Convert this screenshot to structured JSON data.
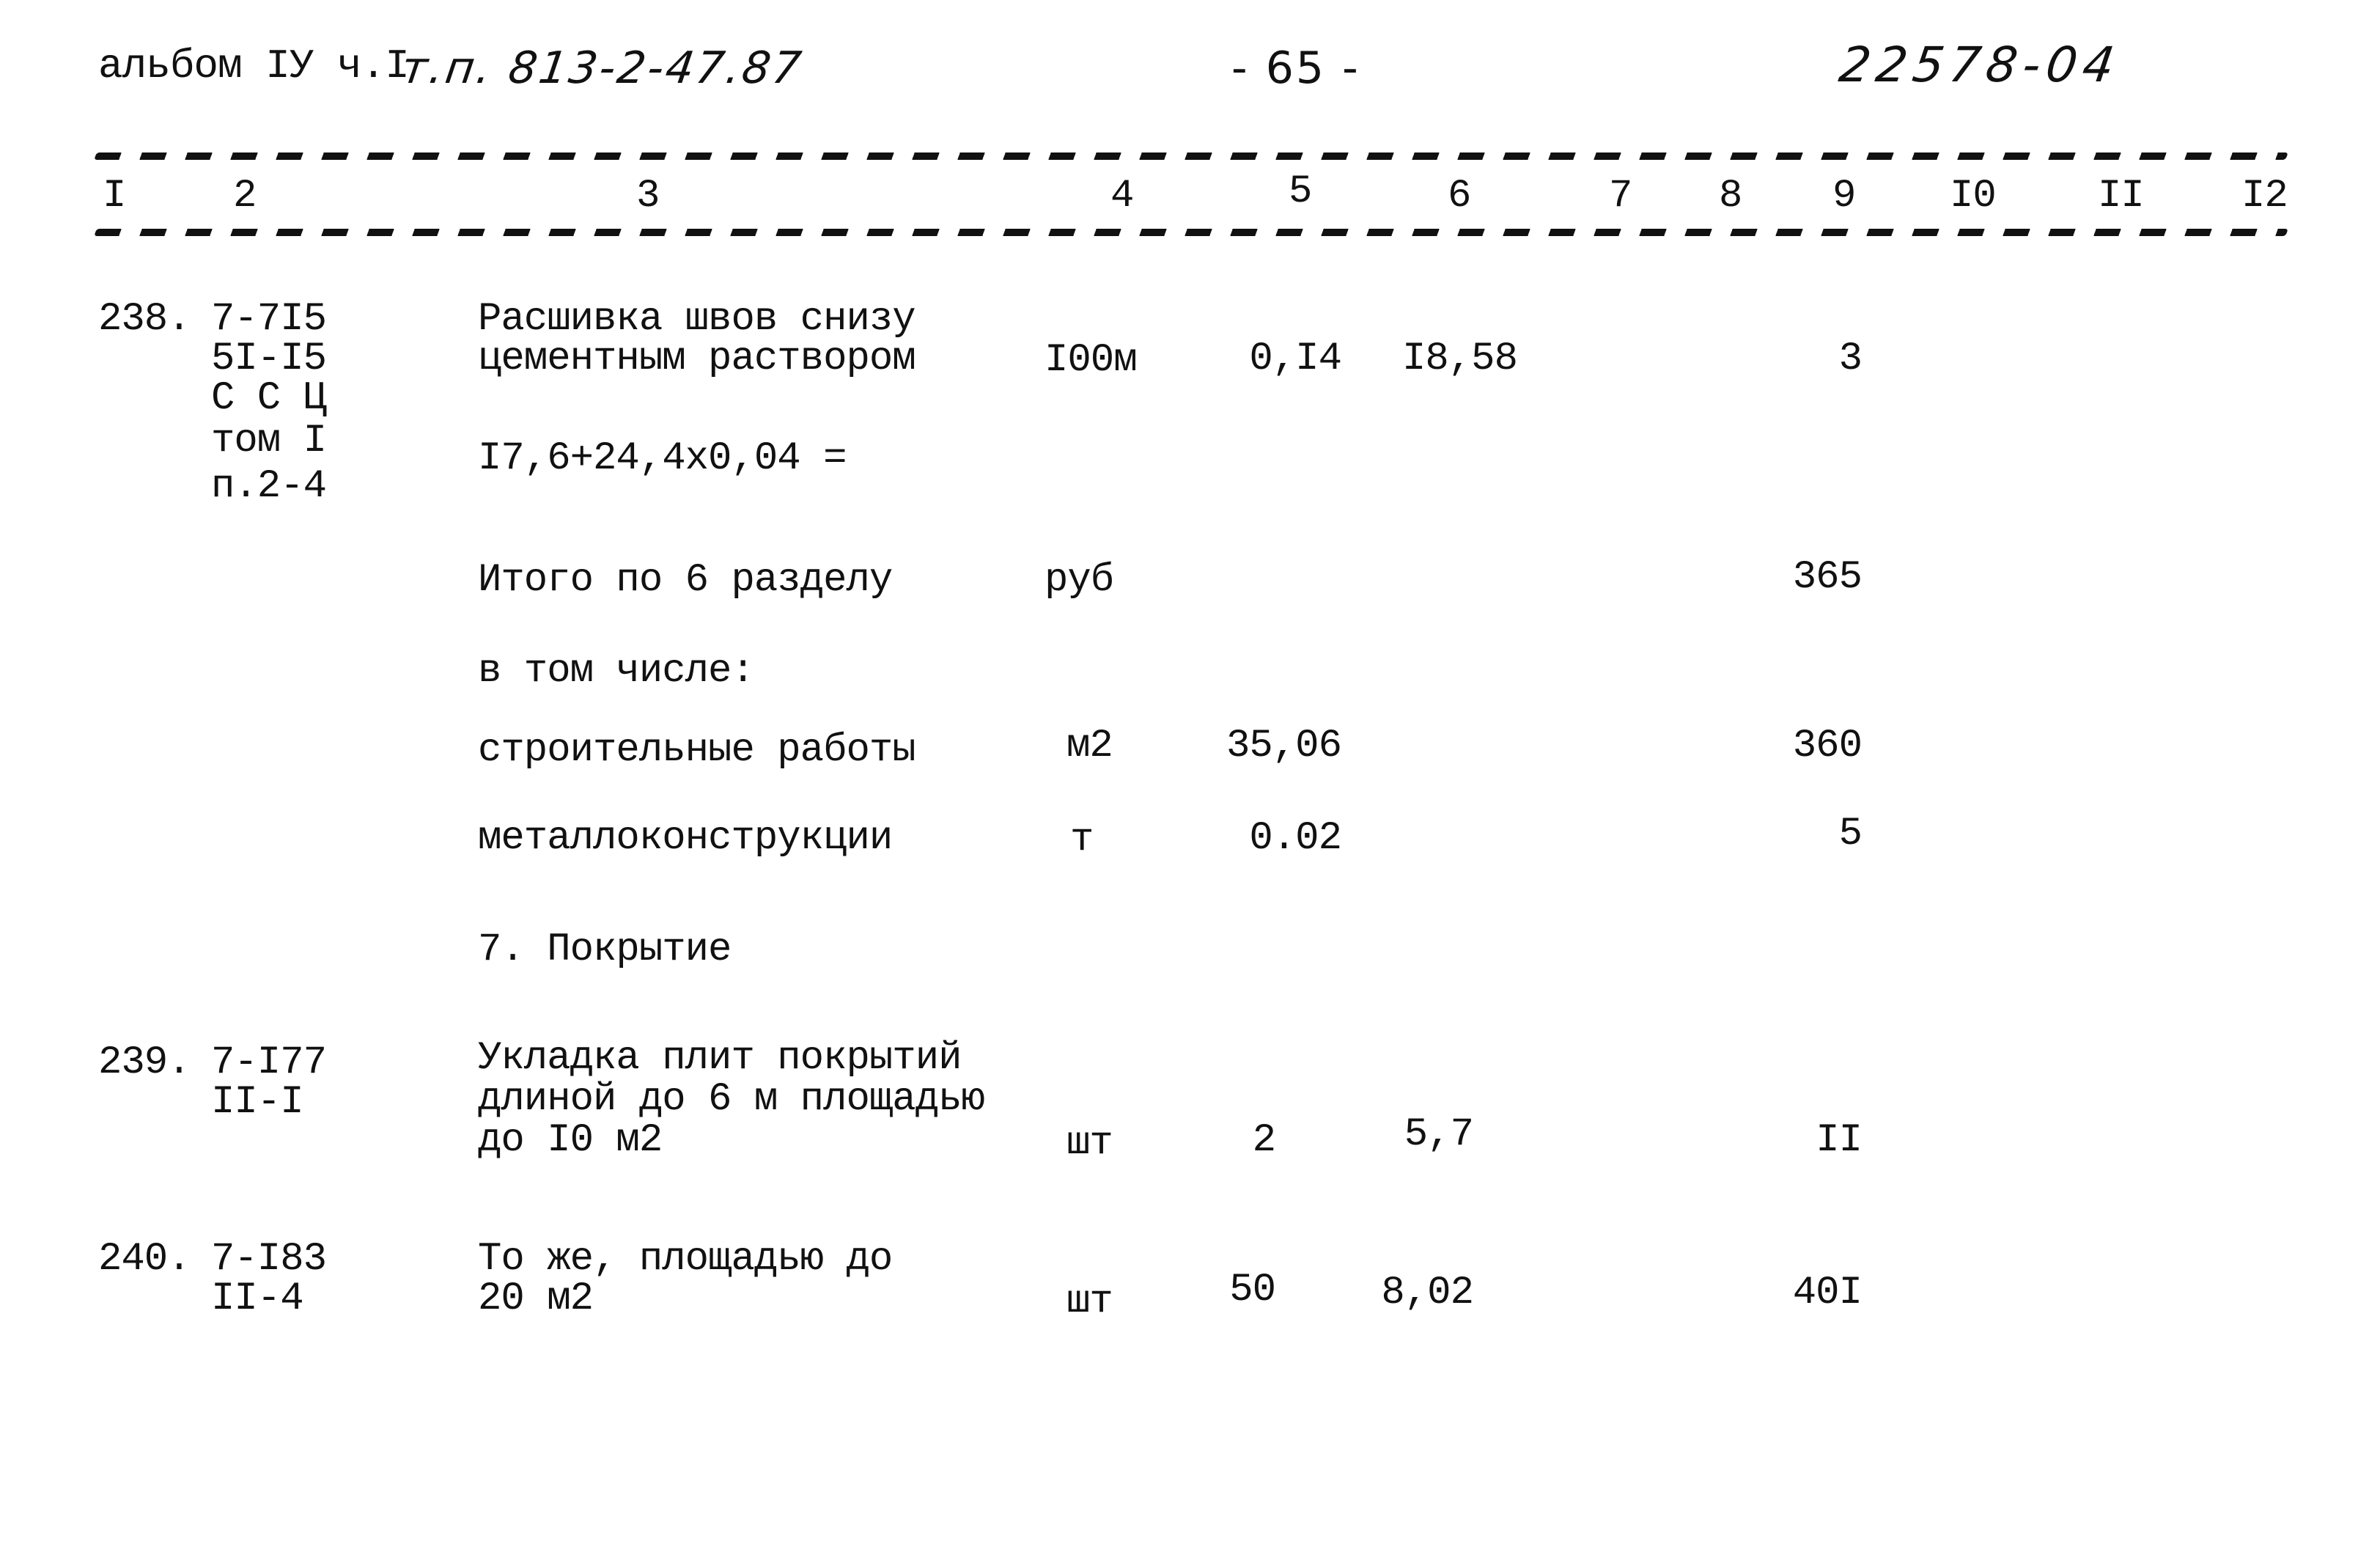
{
  "header": {
    "album_label": "альбом IУ ч.I",
    "project_code_handwritten": "т.п. 813-2-47.87",
    "page_number": "- 65 -",
    "doc_number_handwritten": "22578-04"
  },
  "columns": [
    "I",
    "2",
    "3",
    "4",
    "5",
    "6",
    "7",
    "8",
    "9",
    "I0",
    "II",
    "I2"
  ],
  "rows": [
    {
      "num": "238.",
      "code_lines": [
        "7-7I5",
        "5I-I5",
        "С С Ц",
        "том I",
        "п.2-4"
      ],
      "desc_lines": [
        "Расшивка швов снизу",
        "цементным раствором"
      ],
      "formula": "I7,6+24,4х0,04 =",
      "unit": "I00м",
      "qty": "0,I4",
      "price": "I8,58",
      "total": "3"
    },
    {
      "type": "subtotal",
      "desc": "Итого по 6 разделу",
      "unit": "руб",
      "total": "365"
    },
    {
      "type": "note",
      "desc": "в том числе:"
    },
    {
      "type": "subtotal",
      "desc": "строительные работы",
      "unit": "м2",
      "qty": "35,06",
      "total": "360"
    },
    {
      "type": "subtotal",
      "desc": "металлоконструкции",
      "unit": "т",
      "qty": "0.02",
      "total": "5"
    },
    {
      "type": "section",
      "desc": "7. Покрытие"
    },
    {
      "num": "239.",
      "code_lines": [
        "7-I77",
        "II-I"
      ],
      "desc_lines": [
        "Укладка плит покрытий",
        "длиной до 6 м площадью",
        "до I0 м2"
      ],
      "unit": "шт",
      "qty": "2",
      "price": "5,7",
      "total": "II"
    },
    {
      "num": "240.",
      "code_lines": [
        "7-I83",
        "II-4"
      ],
      "desc_lines": [
        "То же, площадью до",
        "20 м2"
      ],
      "unit": "шт",
      "qty": "50",
      "price": "8,02",
      "total": "40I"
    }
  ]
}
